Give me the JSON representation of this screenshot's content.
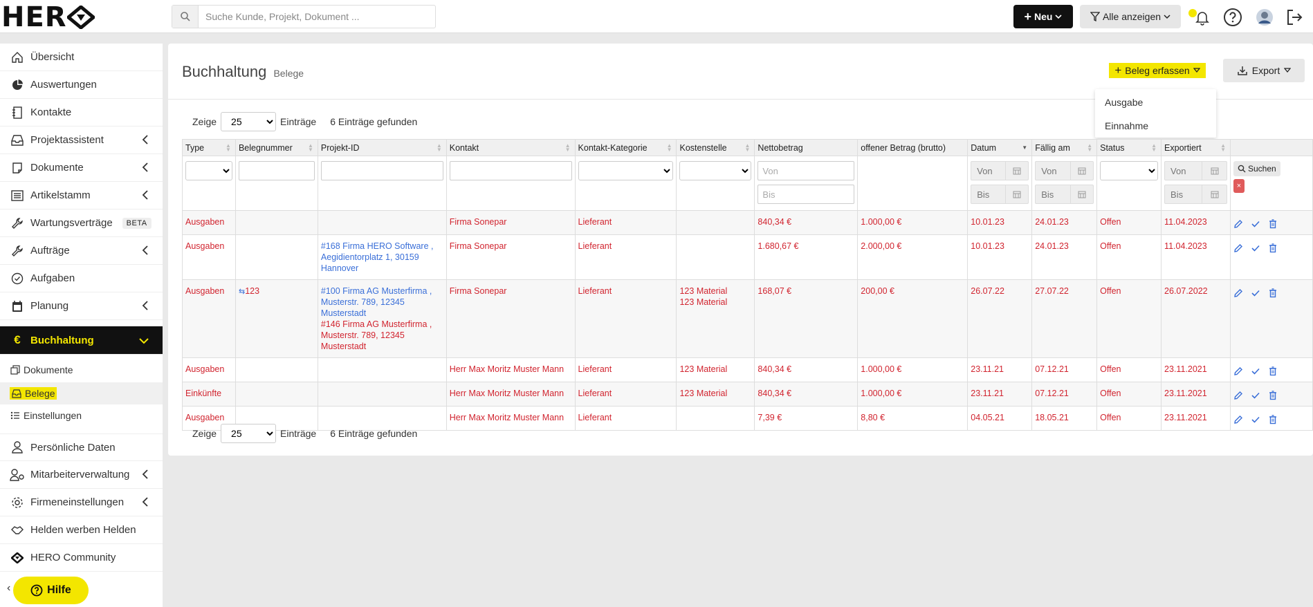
{
  "brand": {
    "logo_text": "HER"
  },
  "search": {
    "placeholder": "Suche Kunde, Projekt, Dokument ..."
  },
  "topbar": {
    "new_label": "Neu",
    "filter_label": "Alle anzeigen"
  },
  "sidebar": {
    "items": [
      {
        "label": "Übersicht"
      },
      {
        "label": "Auswertungen"
      },
      {
        "label": "Kontakte"
      },
      {
        "label": "Projektassistent"
      },
      {
        "label": "Dokumente"
      },
      {
        "label": "Artikelstamm"
      },
      {
        "label": "Wartungsverträge",
        "badge": "BETA"
      },
      {
        "label": "Aufträge"
      },
      {
        "label": "Aufgaben"
      },
      {
        "label": "Planung"
      },
      {
        "label": "Buchhaltung"
      },
      {
        "label": "Persönliche Daten"
      },
      {
        "label": "Mitarbeiterverwaltung"
      },
      {
        "label": "Firmeneinstellungen"
      },
      {
        "label": "Helden werben Helden"
      },
      {
        "label": "HERO Community"
      }
    ],
    "sub_items": [
      {
        "label": "Dokumente"
      },
      {
        "label": "Belege"
      },
      {
        "label": "Einstellungen"
      }
    ],
    "help_label": "Hilfe"
  },
  "page": {
    "title": "Buchhaltung",
    "subtitle": "Belege",
    "add_button_label": "Beleg erfassen",
    "export_label": "Export",
    "dropdown": [
      "Ausgabe",
      "Einnahme"
    ]
  },
  "length": {
    "prefix": "Zeige",
    "value": "25",
    "suffix": "Einträge",
    "found": "6 Einträge gefunden"
  },
  "table": {
    "columns": [
      "Type",
      "Belegnummer",
      "Projekt-ID",
      "Kontakt",
      "Kontakt-Kategorie",
      "Kostenstelle",
      "Nettobetrag",
      "offener Betrag (brutto)",
      "Datum",
      "Fällig am",
      "Status",
      "Exportiert"
    ],
    "filter": {
      "from": "Von",
      "to": "Bis",
      "search": "Suchen",
      "reset": "×"
    },
    "rows": [
      {
        "type": "Ausgaben",
        "number": "",
        "project": "",
        "contact": "Firma Sonepar",
        "category": "Lieferant",
        "cost_center": "",
        "net": "840,34 €",
        "open": "1.000,00 €",
        "date": "10.01.23",
        "due": "24.01.23",
        "status": "Offen",
        "exported": "11.04.2023"
      },
      {
        "type": "Ausgaben",
        "number": "",
        "project": "#168 Firma HERO Software , Aegidientorplatz 1, 30159 Hannover",
        "contact": "Firma Sonepar",
        "category": "Lieferant",
        "cost_center": "",
        "net": "1.680,67 €",
        "open": "2.000,00 €",
        "date": "10.01.23",
        "due": "24.01.23",
        "status": "Offen",
        "exported": "11.04.2023"
      },
      {
        "type": "Ausgaben",
        "number": "123",
        "project": "#100 Firma AG Musterfirma , Musterstr. 789, 12345 Musterstadt",
        "project2": "#146 Firma AG Musterfirma , Musterstr. 789, 12345 Musterstadt",
        "contact": "Firma Sonepar",
        "category": "Lieferant",
        "cost_center": "123 Material",
        "cost_center2": "123 Material",
        "net": "168,07 €",
        "open": "200,00 €",
        "date": "26.07.22",
        "due": "27.07.22",
        "status": "Offen",
        "exported": "26.07.2022"
      },
      {
        "type": "Ausgaben",
        "number": "",
        "project": "",
        "contact": "Herr Max Moritz Muster Mann",
        "category": "Lieferant",
        "cost_center": "123 Material",
        "net": "840,34 €",
        "open": "1.000,00 €",
        "date": "23.11.21",
        "due": "07.12.21",
        "status": "Offen",
        "exported": "23.11.2021"
      },
      {
        "type": "Einkünfte",
        "number": "",
        "project": "",
        "contact": "Herr Max Moritz Muster Mann",
        "category": "Lieferant",
        "cost_center": "123 Material",
        "net": "840,34 €",
        "open": "1.000,00 €",
        "date": "23.11.21",
        "due": "07.12.21",
        "status": "Offen",
        "exported": "23.11.2021"
      },
      {
        "type": "Ausgaben",
        "number": "",
        "project": "",
        "contact": "Herr Max Moritz Muster Mann",
        "category": "Lieferant",
        "cost_center": "",
        "net": "7,39 €",
        "open": "8,80 €",
        "date": "04.05.21",
        "due": "18.05.21",
        "status": "Offen",
        "exported": "23.11.2021"
      }
    ]
  },
  "colors": {
    "accent": "#f3e600",
    "negative": "#d1242f",
    "link": "#3a6fd8",
    "dark": "#111111"
  }
}
